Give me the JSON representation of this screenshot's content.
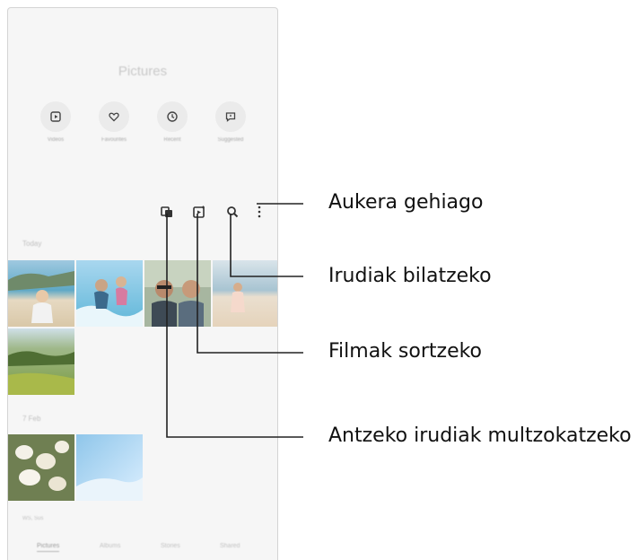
{
  "app": {
    "title": "Pictures",
    "quick_actions": [
      {
        "label": "Videos",
        "icon": "video-play-icon"
      },
      {
        "label": "Favourites",
        "icon": "heart-icon"
      },
      {
        "label": "Recent",
        "icon": "clock-icon"
      },
      {
        "label": "Suggested",
        "icon": "suggestion-icon"
      }
    ],
    "toolbar": [
      {
        "name": "group-similar-icon"
      },
      {
        "name": "create-movie-icon"
      },
      {
        "name": "search-icon"
      },
      {
        "name": "more-options-icon"
      }
    ],
    "sections": [
      {
        "label": "Today"
      },
      {
        "label": "7 Feb"
      }
    ],
    "location_text": "WS, Sus",
    "bottom_tabs": [
      {
        "label": "Pictures",
        "active": true
      },
      {
        "label": "Albums",
        "active": false
      },
      {
        "label": "Stories",
        "active": false
      },
      {
        "label": "Shared",
        "active": false
      }
    ]
  },
  "callouts": [
    {
      "text": "Aukera gehiago"
    },
    {
      "text": "Irudiak bilatzeko"
    },
    {
      "text": "Filmak sortzeko"
    },
    {
      "text": "Antzeko irudiak multzokatzeko"
    }
  ],
  "colors": {
    "line": "#222222",
    "phone_bg": "#f6f6f6"
  }
}
